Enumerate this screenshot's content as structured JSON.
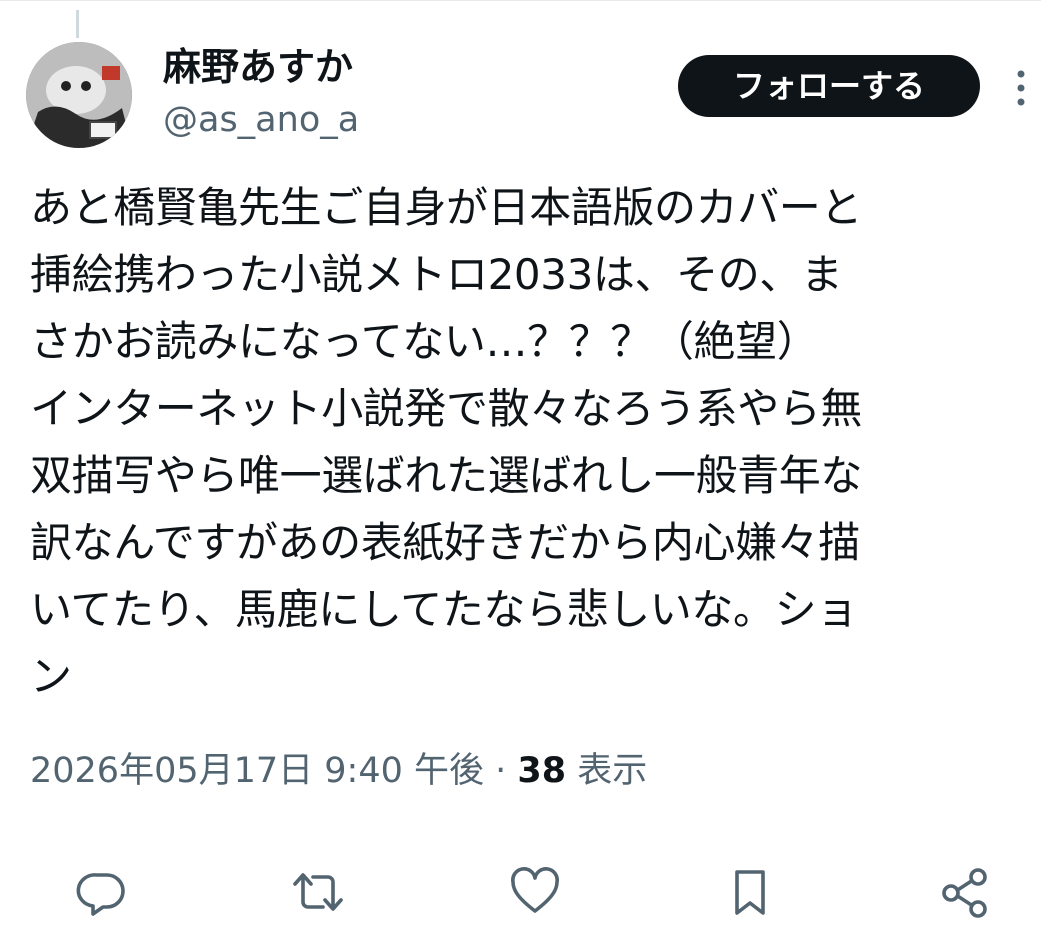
{
  "author": {
    "display_name": "麻野あすか",
    "handle": "@as_ano_a",
    "avatar_icon": "avatar-image"
  },
  "follow_button": {
    "label": "フォローする",
    "color": "#0f1419"
  },
  "tweet": {
    "lines": [
      "あと橋賢亀先生ご自身が日本語版のカバーと",
      "挿絵携わった小説メトロ2033は、その、ま",
      "さかお読みになってない…？？？（絶望）",
      "インターネット小説発で散々なろう系やら無",
      "双描写やら唯一選ばれた選ばれし一般青年な",
      "訳なんですがあの表紙好きだから内心嫌々描",
      "いてたり、馬鹿にしてたなら悲しいな。ショ",
      "ン"
    ]
  },
  "meta": {
    "timestamp": "2026年05月17日 9:40 午後",
    "separator": " · ",
    "views_count": "38",
    "views_label": " 表示"
  },
  "actions": [
    {
      "name": "reply-icon"
    },
    {
      "name": "retweet-icon"
    },
    {
      "name": "like-icon"
    },
    {
      "name": "bookmark-icon"
    },
    {
      "name": "share-icon"
    }
  ],
  "colors": {
    "text_primary": "#0f1419",
    "text_secondary": "#536471",
    "icon": "#536471",
    "divider": "#e6e9ec"
  }
}
